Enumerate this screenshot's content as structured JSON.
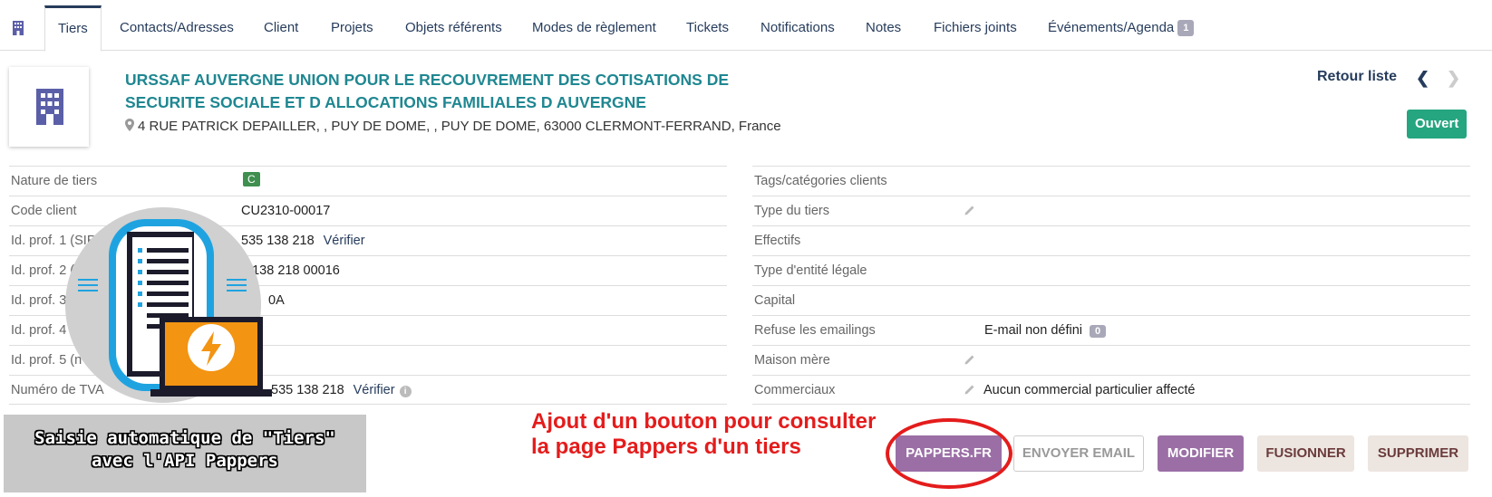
{
  "tabs": [
    {
      "label": "Tiers",
      "active": true
    },
    {
      "label": "Contacts/Adresses"
    },
    {
      "label": "Client"
    },
    {
      "label": "Projets"
    },
    {
      "label": "Objets référents"
    },
    {
      "label": "Modes de règlement"
    },
    {
      "label": "Tickets"
    },
    {
      "label": "Notifications"
    },
    {
      "label": "Notes"
    },
    {
      "label": "Fichiers joints"
    },
    {
      "label": "Événements/Agenda",
      "badge": "1"
    }
  ],
  "header": {
    "company_name": "URSSAF AUVERGNE UNION POUR LE RECOUVREMENT DES COTISATIONS DE SECURITE SOCIALE ET D ALLOCATIONS FAMILIALES D AUVERGNE",
    "address": "4 RUE PATRICK DEPAILLER, , PUY DE DOME, , PUY DE DOME, 63000 CLERMONT-FERRAND, France",
    "back_link": "Retour liste",
    "prev_icon": "chevron-left-icon",
    "next_icon": "chevron-right-icon",
    "status": "Ouvert",
    "status_color": "#25a580",
    "name_color": "#1f8791"
  },
  "left_table": {
    "nature_label": "Nature de tiers",
    "nature_tag": "C",
    "code_label": "Code client",
    "code_value": "CU2310-00017",
    "id1_label": "Id. prof. 1 (SIR",
    "id1_value": "535 138 218",
    "id1_link": "Vérifier",
    "id2_label": "Id. prof. 2 (",
    "id2_value": "5 138 218 00016",
    "id3_label": "Id. prof. 3",
    "id3_value": "0A",
    "id4_label": "Id. prof. 4 (",
    "id5_label": "Id. prof. 5 (n",
    "tva_label": "Numéro de TVA",
    "tva_value": "535 138 218",
    "tva_link": "Vérifier"
  },
  "right_table": {
    "tags_label": "Tags/catégories clients",
    "type_label": "Type du tiers",
    "effectifs_label": "Effectifs",
    "entite_label": "Type d'entité légale",
    "capital_label": "Capital",
    "emailings_label": "Refuse les emailings",
    "emailings_value": "E-mail non défini",
    "emailings_badge": "0",
    "maison_label": "Maison mère",
    "commerciaux_label": "Commerciaux",
    "commerciaux_value": "Aucun commercial particulier affecté"
  },
  "buttons": {
    "pappers": "PAPPERS.FR",
    "email": "ENVOYER EMAIL",
    "modifier": "MODIFIER",
    "fusionner": "FUSIONNER",
    "supprimer": "SUPPRIMER"
  },
  "annotation": {
    "line1": "Ajout d'un bouton pour consulter",
    "line2": "la page Pappers d'un tiers"
  },
  "overlay_caption": {
    "line1": "Saisie automatique de \"Tiers\"",
    "line2": "avec l'API Pappers"
  }
}
